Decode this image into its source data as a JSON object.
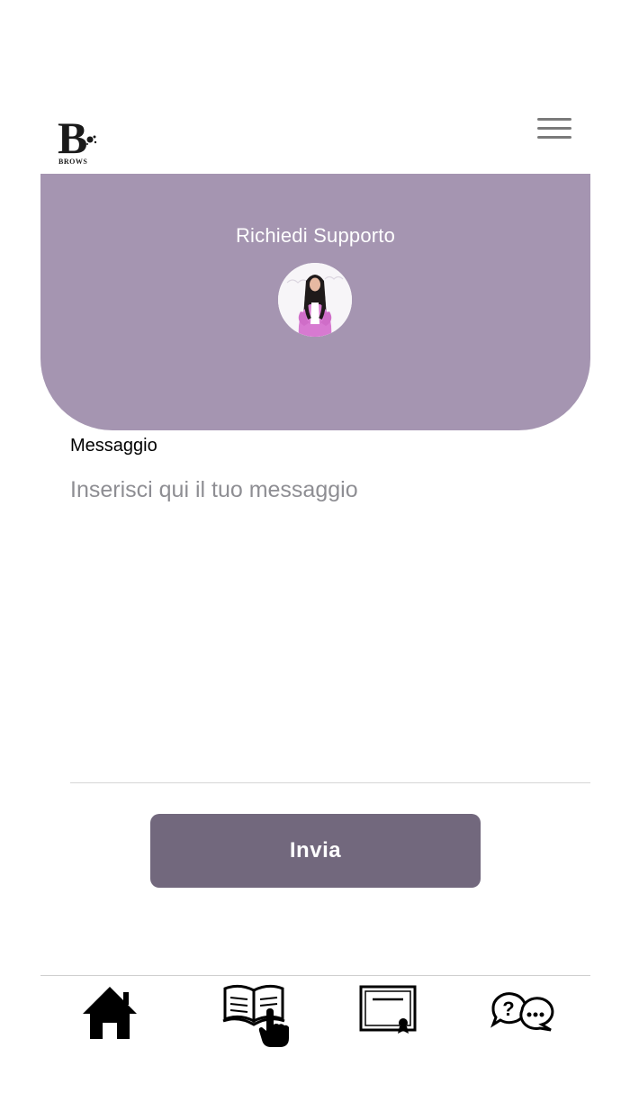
{
  "header": {
    "logo_text": "BROWS",
    "logo_letter": "B"
  },
  "hero": {
    "title": "Richiedi Supporto"
  },
  "form": {
    "message_label": "Messaggio",
    "message_placeholder": "Inserisci qui il tuo messaggio",
    "message_value": "",
    "submit_label": "Invia"
  },
  "tabbar": {
    "items": [
      {
        "icon": "home-icon"
      },
      {
        "icon": "book-touch-icon"
      },
      {
        "icon": "certificate-icon"
      },
      {
        "icon": "faq-chat-icon"
      }
    ]
  },
  "colors": {
    "hero_bg": "#a595b1",
    "button_bg": "#72687d",
    "menu_icon": "#7a7a7a"
  }
}
